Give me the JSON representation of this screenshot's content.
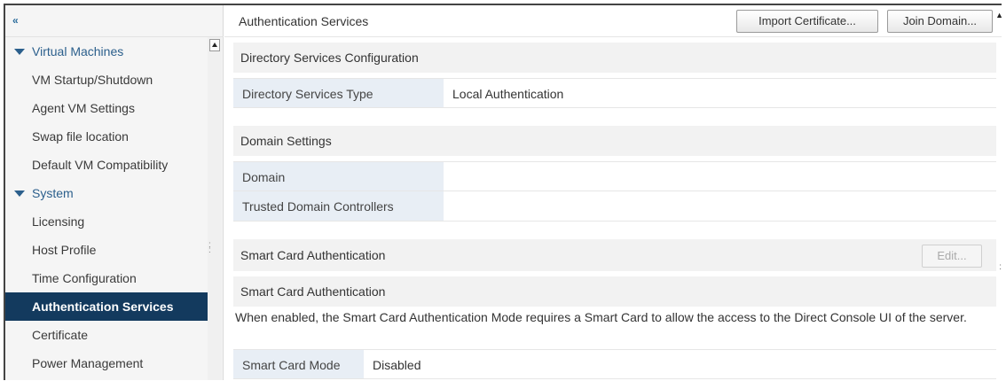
{
  "sidebar": {
    "collapse_icon": "«",
    "items": [
      {
        "label": "Virtual Machines",
        "type": "group"
      },
      {
        "label": "VM Startup/Shutdown",
        "type": "item"
      },
      {
        "label": "Agent VM Settings",
        "type": "item"
      },
      {
        "label": "Swap file location",
        "type": "item"
      },
      {
        "label": "Default VM Compatibility",
        "type": "item"
      },
      {
        "label": "System",
        "type": "group"
      },
      {
        "label": "Licensing",
        "type": "item"
      },
      {
        "label": "Host Profile",
        "type": "item"
      },
      {
        "label": "Time Configuration",
        "type": "item"
      },
      {
        "label": "Authentication Services",
        "type": "item",
        "selected": true
      },
      {
        "label": "Certificate",
        "type": "item"
      },
      {
        "label": "Power Management",
        "type": "item"
      }
    ]
  },
  "header": {
    "title": "Authentication Services",
    "import_certificate": "Import Certificate...",
    "join_domain": "Join Domain..."
  },
  "directory": {
    "section_title": "Directory Services Configuration",
    "type_label": "Directory Services Type",
    "type_value": "Local Authentication"
  },
  "domain": {
    "section_title": "Domain Settings",
    "domain_label": "Domain",
    "domain_value": "",
    "controllers_label": "Trusted Domain Controllers",
    "controllers_value": ""
  },
  "smartcard": {
    "section_title": "Smart Card Authentication",
    "edit_label": "Edit...",
    "sub_title": "Smart Card Authentication",
    "description": "When enabled, the Smart Card Authentication Mode requires a Smart Card to allow the access to the Direct Console UI of the server.",
    "mode_label": "Smart Card Mode",
    "mode_value": "Disabled"
  },
  "colors": {
    "selected_bg": "#133a5e",
    "group_text": "#2b5f8c",
    "key_cell_bg": "#e8eef5"
  }
}
